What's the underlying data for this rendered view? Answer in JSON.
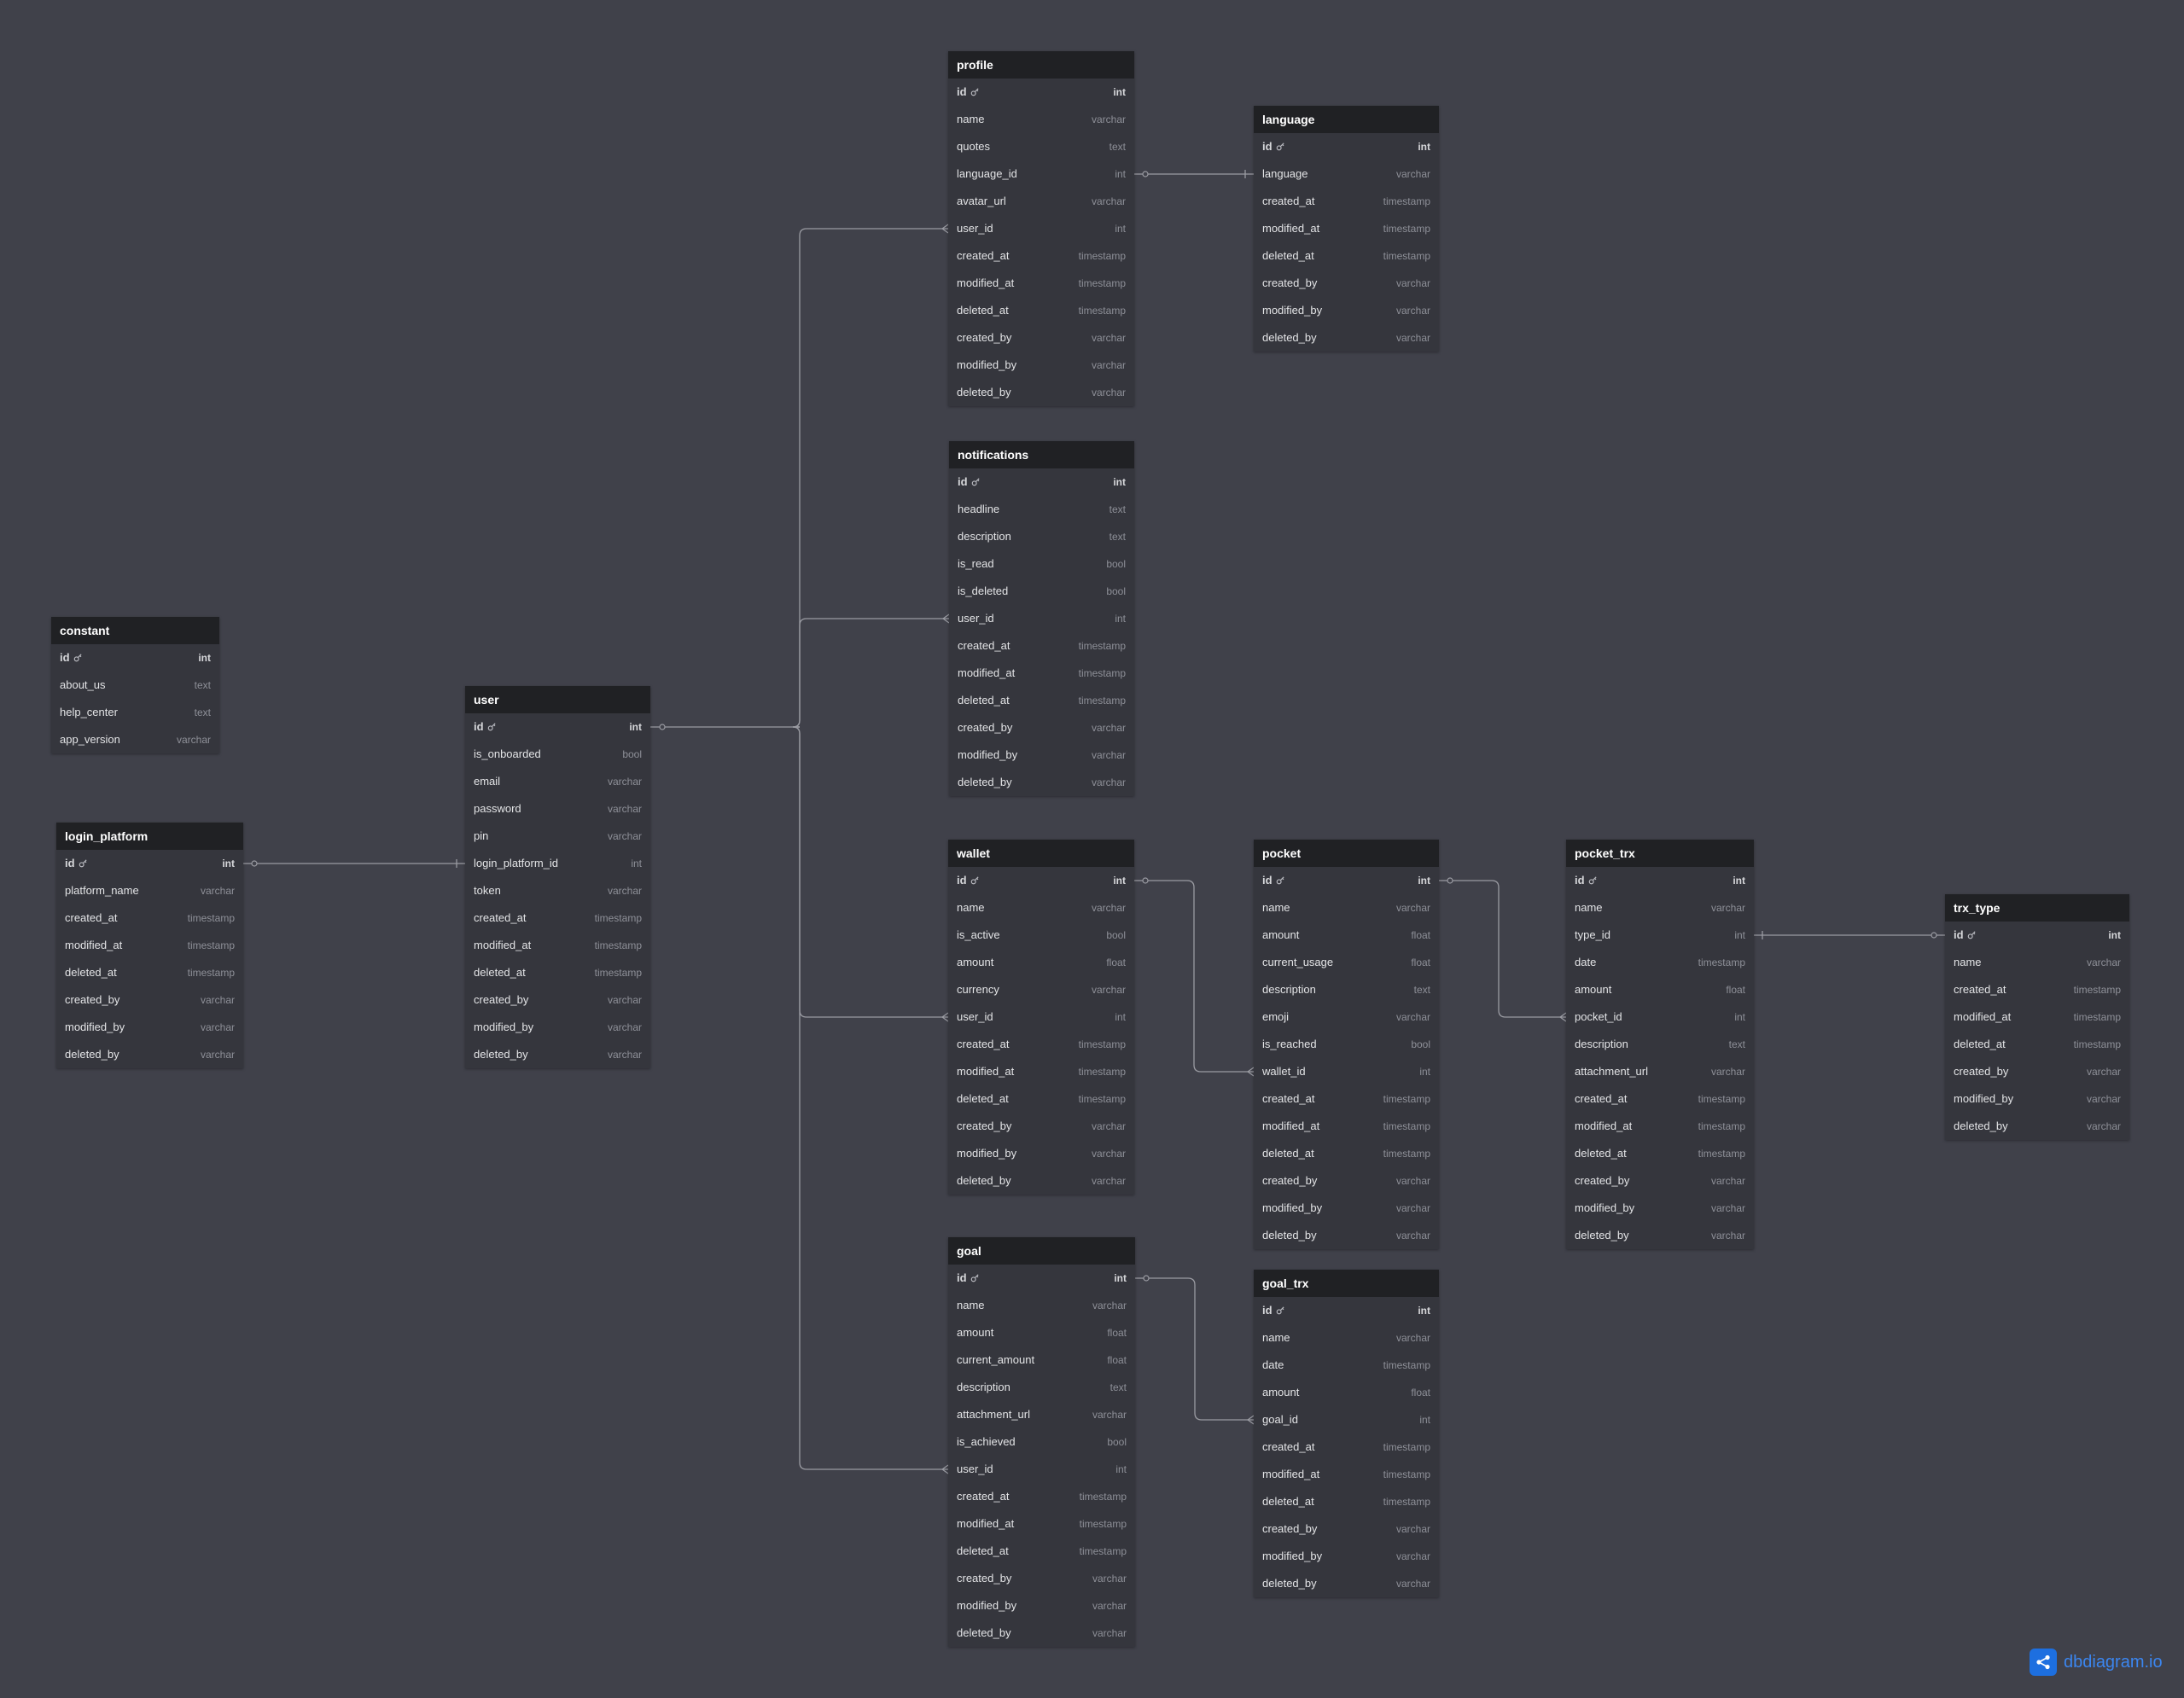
{
  "colors": {
    "background": "#40414a",
    "table_body": "#35363d",
    "table_header": "#202124",
    "connector": "#9a9ba2",
    "brand": "#1d6fe0"
  },
  "tables": [
    {
      "id": "profile",
      "name": "profile",
      "fields": [
        {
          "name": "id",
          "type": "int",
          "pk": true
        },
        {
          "name": "name",
          "type": "varchar"
        },
        {
          "name": "quotes",
          "type": "text"
        },
        {
          "name": "language_id",
          "type": "int"
        },
        {
          "name": "avatar_url",
          "type": "varchar"
        },
        {
          "name": "user_id",
          "type": "int"
        },
        {
          "name": "created_at",
          "type": "timestamp"
        },
        {
          "name": "modified_at",
          "type": "timestamp"
        },
        {
          "name": "deleted_at",
          "type": "timestamp"
        },
        {
          "name": "created_by",
          "type": "varchar"
        },
        {
          "name": "modified_by",
          "type": "varchar"
        },
        {
          "name": "deleted_by",
          "type": "varchar"
        }
      ]
    },
    {
      "id": "language",
      "name": "language",
      "fields": [
        {
          "name": "id",
          "type": "int",
          "pk": true
        },
        {
          "name": "language",
          "type": "varchar"
        },
        {
          "name": "created_at",
          "type": "timestamp"
        },
        {
          "name": "modified_at",
          "type": "timestamp"
        },
        {
          "name": "deleted_at",
          "type": "timestamp"
        },
        {
          "name": "created_by",
          "type": "varchar"
        },
        {
          "name": "modified_by",
          "type": "varchar"
        },
        {
          "name": "deleted_by",
          "type": "varchar"
        }
      ]
    },
    {
      "id": "notifications",
      "name": "notifications",
      "fields": [
        {
          "name": "id",
          "type": "int",
          "pk": true
        },
        {
          "name": "headline",
          "type": "text"
        },
        {
          "name": "description",
          "type": "text"
        },
        {
          "name": "is_read",
          "type": "bool"
        },
        {
          "name": "is_deleted",
          "type": "bool"
        },
        {
          "name": "user_id",
          "type": "int"
        },
        {
          "name": "created_at",
          "type": "timestamp"
        },
        {
          "name": "modified_at",
          "type": "timestamp"
        },
        {
          "name": "deleted_at",
          "type": "timestamp"
        },
        {
          "name": "created_by",
          "type": "varchar"
        },
        {
          "name": "modified_by",
          "type": "varchar"
        },
        {
          "name": "deleted_by",
          "type": "varchar"
        }
      ]
    },
    {
      "id": "constant",
      "name": "constant",
      "fields": [
        {
          "name": "id",
          "type": "int",
          "pk": true
        },
        {
          "name": "about_us",
          "type": "text"
        },
        {
          "name": "help_center",
          "type": "text"
        },
        {
          "name": "app_version",
          "type": "varchar"
        }
      ]
    },
    {
      "id": "user",
      "name": "user",
      "fields": [
        {
          "name": "id",
          "type": "int",
          "pk": true
        },
        {
          "name": "is_onboarded",
          "type": "bool"
        },
        {
          "name": "email",
          "type": "varchar"
        },
        {
          "name": "password",
          "type": "varchar"
        },
        {
          "name": "pin",
          "type": "varchar"
        },
        {
          "name": "login_platform_id",
          "type": "int"
        },
        {
          "name": "token",
          "type": "varchar"
        },
        {
          "name": "created_at",
          "type": "timestamp"
        },
        {
          "name": "modified_at",
          "type": "timestamp"
        },
        {
          "name": "deleted_at",
          "type": "timestamp"
        },
        {
          "name": "created_by",
          "type": "varchar"
        },
        {
          "name": "modified_by",
          "type": "varchar"
        },
        {
          "name": "deleted_by",
          "type": "varchar"
        }
      ]
    },
    {
      "id": "login_platform",
      "name": "login_platform",
      "fields": [
        {
          "name": "id",
          "type": "int",
          "pk": true
        },
        {
          "name": "platform_name",
          "type": "varchar"
        },
        {
          "name": "created_at",
          "type": "timestamp"
        },
        {
          "name": "modified_at",
          "type": "timestamp"
        },
        {
          "name": "deleted_at",
          "type": "timestamp"
        },
        {
          "name": "created_by",
          "type": "varchar"
        },
        {
          "name": "modified_by",
          "type": "varchar"
        },
        {
          "name": "deleted_by",
          "type": "varchar"
        }
      ]
    },
    {
      "id": "wallet",
      "name": "wallet",
      "fields": [
        {
          "name": "id",
          "type": "int",
          "pk": true
        },
        {
          "name": "name",
          "type": "varchar"
        },
        {
          "name": "is_active",
          "type": "bool"
        },
        {
          "name": "amount",
          "type": "float"
        },
        {
          "name": "currency",
          "type": "varchar"
        },
        {
          "name": "user_id",
          "type": "int"
        },
        {
          "name": "created_at",
          "type": "timestamp"
        },
        {
          "name": "modified_at",
          "type": "timestamp"
        },
        {
          "name": "deleted_at",
          "type": "timestamp"
        },
        {
          "name": "created_by",
          "type": "varchar"
        },
        {
          "name": "modified_by",
          "type": "varchar"
        },
        {
          "name": "deleted_by",
          "type": "varchar"
        }
      ]
    },
    {
      "id": "pocket",
      "name": "pocket",
      "fields": [
        {
          "name": "id",
          "type": "int",
          "pk": true
        },
        {
          "name": "name",
          "type": "varchar"
        },
        {
          "name": "amount",
          "type": "float"
        },
        {
          "name": "current_usage",
          "type": "float"
        },
        {
          "name": "description",
          "type": "text"
        },
        {
          "name": "emoji",
          "type": "varchar"
        },
        {
          "name": "is_reached",
          "type": "bool"
        },
        {
          "name": "wallet_id",
          "type": "int"
        },
        {
          "name": "created_at",
          "type": "timestamp"
        },
        {
          "name": "modified_at",
          "type": "timestamp"
        },
        {
          "name": "deleted_at",
          "type": "timestamp"
        },
        {
          "name": "created_by",
          "type": "varchar"
        },
        {
          "name": "modified_by",
          "type": "varchar"
        },
        {
          "name": "deleted_by",
          "type": "varchar"
        }
      ]
    },
    {
      "id": "pocket_trx",
      "name": "pocket_trx",
      "fields": [
        {
          "name": "id",
          "type": "int",
          "pk": true
        },
        {
          "name": "name",
          "type": "varchar"
        },
        {
          "name": "type_id",
          "type": "int"
        },
        {
          "name": "date",
          "type": "timestamp"
        },
        {
          "name": "amount",
          "type": "float"
        },
        {
          "name": "pocket_id",
          "type": "int"
        },
        {
          "name": "description",
          "type": "text"
        },
        {
          "name": "attachment_url",
          "type": "varchar"
        },
        {
          "name": "created_at",
          "type": "timestamp"
        },
        {
          "name": "modified_at",
          "type": "timestamp"
        },
        {
          "name": "deleted_at",
          "type": "timestamp"
        },
        {
          "name": "created_by",
          "type": "varchar"
        },
        {
          "name": "modified_by",
          "type": "varchar"
        },
        {
          "name": "deleted_by",
          "type": "varchar"
        }
      ]
    },
    {
      "id": "trx_type",
      "name": "trx_type",
      "fields": [
        {
          "name": "id",
          "type": "int",
          "pk": true
        },
        {
          "name": "name",
          "type": "varchar"
        },
        {
          "name": "created_at",
          "type": "timestamp"
        },
        {
          "name": "modified_at",
          "type": "timestamp"
        },
        {
          "name": "deleted_at",
          "type": "timestamp"
        },
        {
          "name": "created_by",
          "type": "varchar"
        },
        {
          "name": "modified_by",
          "type": "varchar"
        },
        {
          "name": "deleted_by",
          "type": "varchar"
        }
      ]
    },
    {
      "id": "goal",
      "name": "goal",
      "fields": [
        {
          "name": "id",
          "type": "int",
          "pk": true
        },
        {
          "name": "name",
          "type": "varchar"
        },
        {
          "name": "amount",
          "type": "float"
        },
        {
          "name": "current_amount",
          "type": "float"
        },
        {
          "name": "description",
          "type": "text"
        },
        {
          "name": "attachment_url",
          "type": "varchar"
        },
        {
          "name": "is_achieved",
          "type": "bool"
        },
        {
          "name": "user_id",
          "type": "int"
        },
        {
          "name": "created_at",
          "type": "timestamp"
        },
        {
          "name": "modified_at",
          "type": "timestamp"
        },
        {
          "name": "deleted_at",
          "type": "timestamp"
        },
        {
          "name": "created_by",
          "type": "varchar"
        },
        {
          "name": "modified_by",
          "type": "varchar"
        },
        {
          "name": "deleted_by",
          "type": "varchar"
        }
      ]
    },
    {
      "id": "goal_trx",
      "name": "goal_trx",
      "fields": [
        {
          "name": "id",
          "type": "int",
          "pk": true
        },
        {
          "name": "name",
          "type": "varchar"
        },
        {
          "name": "date",
          "type": "timestamp"
        },
        {
          "name": "amount",
          "type": "float"
        },
        {
          "name": "goal_id",
          "type": "int"
        },
        {
          "name": "created_at",
          "type": "timestamp"
        },
        {
          "name": "modified_at",
          "type": "timestamp"
        },
        {
          "name": "deleted_at",
          "type": "timestamp"
        },
        {
          "name": "created_by",
          "type": "varchar"
        },
        {
          "name": "modified_by",
          "type": "varchar"
        },
        {
          "name": "deleted_by",
          "type": "varchar"
        }
      ]
    }
  ],
  "relationships": [
    {
      "from": "user.id",
      "to": "profile.user_id"
    },
    {
      "from": "user.id",
      "to": "notifications.user_id"
    },
    {
      "from": "user.id",
      "to": "wallet.user_id"
    },
    {
      "from": "user.id",
      "to": "goal.user_id"
    },
    {
      "from": "profile.language_id",
      "to": "language.language"
    },
    {
      "from": "login_platform.id",
      "to": "user.login_platform_id"
    },
    {
      "from": "wallet.id",
      "to": "pocket.wallet_id"
    },
    {
      "from": "pocket.id",
      "to": "pocket_trx.pocket_id"
    },
    {
      "from": "pocket_trx.type_id",
      "to": "trx_type.id"
    },
    {
      "from": "goal.id",
      "to": "goal_trx.goal_id"
    }
  ],
  "brand": {
    "label": "dbdiagram.io",
    "icon": "share-icon"
  }
}
